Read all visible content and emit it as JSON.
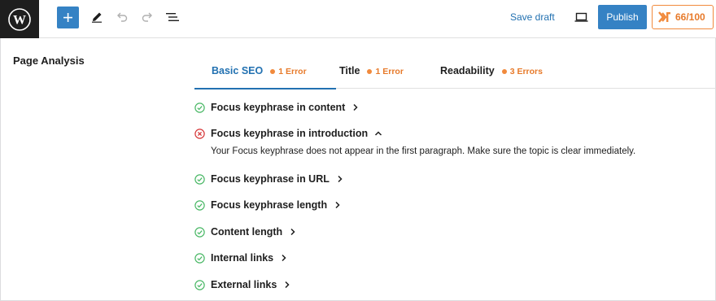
{
  "toolbar": {
    "save_draft_label": "Save draft",
    "publish_label": "Publish",
    "seo_score": "66/100"
  },
  "sidebar": {
    "title": "Page Analysis"
  },
  "tabs": [
    {
      "label": "Basic SEO",
      "badge": "1 Error",
      "active": true
    },
    {
      "label": "Title",
      "badge": "1 Error",
      "active": false
    },
    {
      "label": "Readability",
      "badge": "3 Errors",
      "active": false
    }
  ],
  "results": [
    {
      "label": "Focus keyphrase in content",
      "status": "ok",
      "expanded": false
    },
    {
      "label": "Focus keyphrase in introduction",
      "status": "error",
      "expanded": true,
      "detail": "Your Focus keyphrase does not appear in the first paragraph. Make sure the topic is clear immediately."
    },
    {
      "label": "Focus keyphrase in URL",
      "status": "ok",
      "expanded": false
    },
    {
      "label": "Focus keyphrase length",
      "status": "ok",
      "expanded": false
    },
    {
      "label": "Content length",
      "status": "ok",
      "expanded": false
    },
    {
      "label": "Internal links",
      "status": "ok",
      "expanded": false
    },
    {
      "label": "External links",
      "status": "ok",
      "expanded": false
    }
  ],
  "colors": {
    "accent": "#2271b1",
    "warning": "#f18a3c",
    "ok": "#4ab866",
    "error": "#d63638"
  }
}
